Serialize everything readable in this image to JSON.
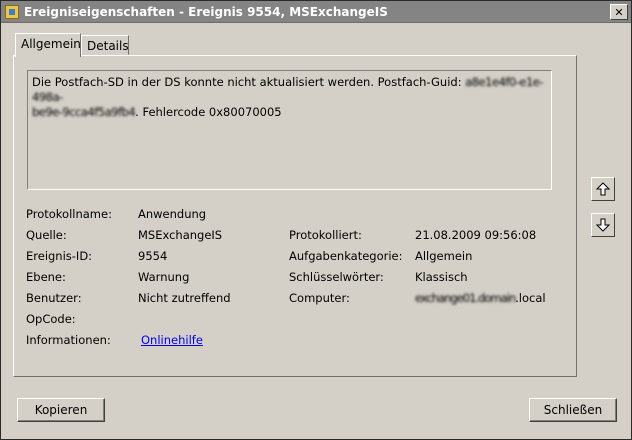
{
  "window": {
    "title": "Ereigniseigenschaften - Ereignis 9554, MSExchangeIS"
  },
  "tabs": [
    {
      "label": "Allgemein"
    },
    {
      "label": "Details"
    }
  ],
  "description": {
    "line1": "Die Postfach-SD in der DS konnte nicht aktualisiert werden. Postfach-Guid: ",
    "line1_redacted": "a8e1e4f0-e1e-498a-",
    "line2_redacted": "be9e-9cca4f5a9fb4",
    "line2": ". Fehlercode 0x80070005"
  },
  "fields": {
    "protokollname_label": "Protokollname:",
    "protokollname_value": "Anwendung",
    "quelle_label": "Quelle:",
    "quelle_value": "MSExchangeIS",
    "ereignis_label": "Ereignis-ID:",
    "ereignis_value": "9554",
    "ebene_label": "Ebene:",
    "ebene_value": "Warnung",
    "benutzer_label": "Benutzer:",
    "benutzer_value": "Nicht zutreffend",
    "opcode_label": "OpCode:",
    "informationen_label": "Informationen:",
    "informationen_link": "Onlinehilfe",
    "protokolliert_label": "Protokolliert:",
    "protokolliert_value": "21.08.2009 09:56:08",
    "aufgaben_label": "Aufgabenkategorie:",
    "aufgaben_value": "Allgemein",
    "schluessel_label": "Schlüsselwörter:",
    "schluessel_value": "Klassisch",
    "computer_label": "Computer:",
    "computer_value_redacted": "exchange01.domain",
    "computer_value_suffix": ".local"
  },
  "buttons": {
    "copy": "Kopieren",
    "close": "Schließen"
  },
  "icons": {
    "close": "close-icon",
    "up": "arrow-up-icon",
    "down": "arrow-down-icon"
  }
}
